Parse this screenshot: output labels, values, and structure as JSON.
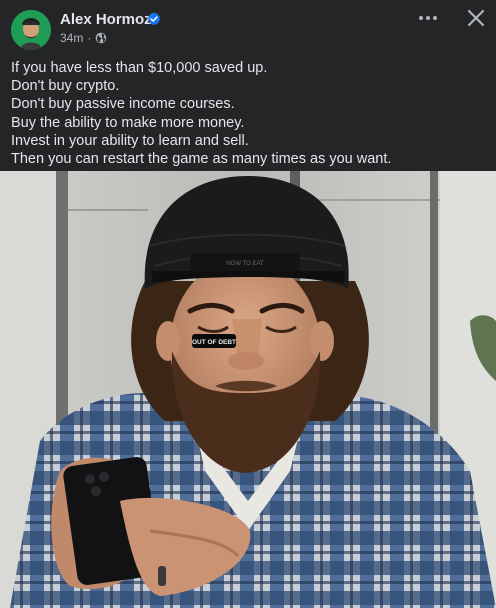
{
  "post": {
    "author": "Alex Hormozi",
    "time": "34m",
    "separator": "·",
    "audience_icon": "globe-icon",
    "lines": [
      "If you have less than $10,000 saved up.",
      "Don't buy crypto.",
      "Don't buy passive income courses.",
      "Buy the ability to make more money.",
      "Invest in your ability to learn and sell.",
      "Then you can restart the game as many times as you want."
    ],
    "cap_patch_text": "HOW TO EAT",
    "nose_patch_text": "OUT OF DEBT"
  },
  "header": {
    "more_icon": "more-options-icon",
    "close_icon": "close-icon"
  },
  "colors": {
    "background": "#242526",
    "text": "#e4e6eb",
    "secondary_text": "#b0b3b8",
    "verified": "#1877f2",
    "avatar_bg": "#1f9d57"
  }
}
